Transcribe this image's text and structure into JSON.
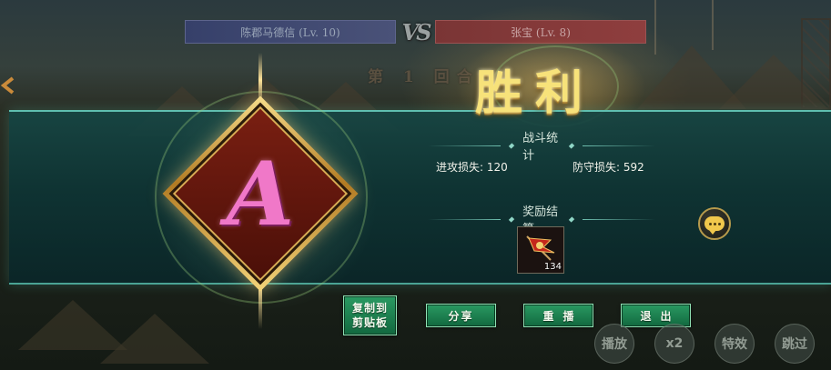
{
  "header": {
    "left_player": "陈郡马德信 (Lv. 10)",
    "vs": "VS",
    "right_player": "张宝 (Lv. 8)",
    "round": "第 1 回合"
  },
  "result": {
    "title": "胜利",
    "grade": "A"
  },
  "stats": {
    "section_title": "战斗统计",
    "attack_loss": "进攻损失: 120",
    "defense_loss": "防守损失: 592"
  },
  "rewards": {
    "section_title": "奖励结算",
    "items": [
      {
        "icon": "war-flag-icon",
        "count": "134"
      }
    ]
  },
  "actions": {
    "copy_line1": "复制到",
    "copy_line2": "剪贴板",
    "share": "分享",
    "replay": "重播",
    "exit": "退出"
  },
  "playback": {
    "play": "播放",
    "speed": "x2",
    "effects": "特效",
    "skip": "跳过"
  },
  "colors": {
    "banner": "#164644",
    "button": "#2a9a62",
    "title_gold": "#f7e27a",
    "grade_pink": "#f078c8"
  }
}
